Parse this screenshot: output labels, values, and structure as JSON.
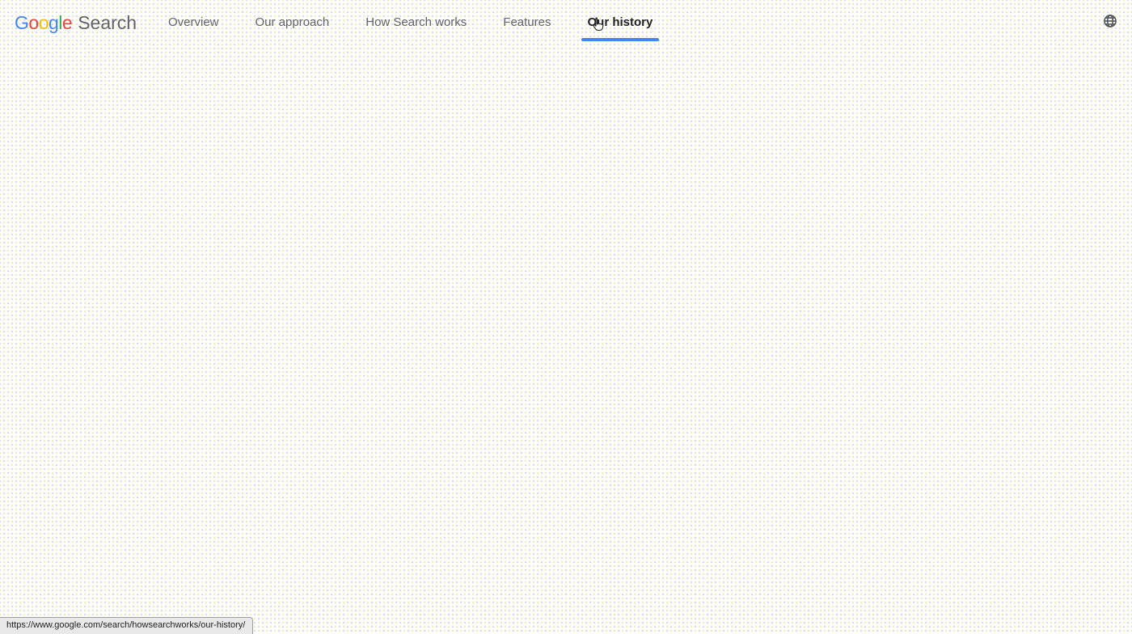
{
  "header": {
    "logo": {
      "letters": [
        {
          "char": "G",
          "color": "#4285F4"
        },
        {
          "char": "o",
          "color": "#EA4335"
        },
        {
          "char": "o",
          "color": "#FBBC05"
        },
        {
          "char": "g",
          "color": "#4285F4"
        },
        {
          "char": "l",
          "color": "#34A853"
        },
        {
          "char": "e",
          "color": "#EA4335"
        }
      ],
      "product": "Search",
      "product_color": "#5f6368"
    },
    "nav": {
      "items": [
        {
          "label": "Overview",
          "active": false
        },
        {
          "label": "Our approach",
          "active": false
        },
        {
          "label": "How Search works",
          "active": false
        },
        {
          "label": "Features",
          "active": false
        },
        {
          "label": "Our history",
          "active": true
        }
      ]
    },
    "icons": {
      "globe": "globe-icon"
    }
  },
  "status_bar": {
    "url": "https://www.google.com/search/howsearchworks/our-history/"
  },
  "cursor": {
    "type": "hand-pointer"
  },
  "colors": {
    "accent_blue": "#4285F4",
    "nav_text": "#5f6368",
    "nav_active_text": "#202124",
    "background": "#ffffff",
    "dot_yellow": "#f0eaac",
    "dot_lavender": "#d9d3f2",
    "statusbar_bg": "#e9e9e9",
    "statusbar_border": "#9e9e9e"
  }
}
